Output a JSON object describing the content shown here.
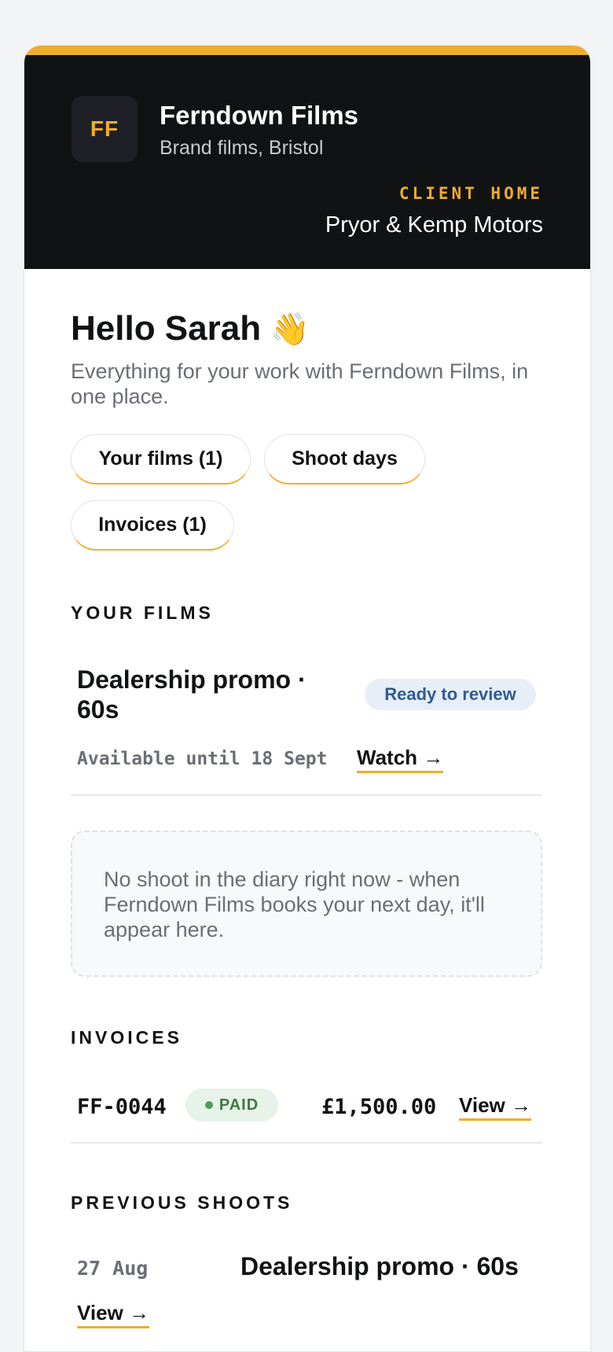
{
  "colors": {
    "accent": "#f0ad2b",
    "header_bg": "#111214",
    "review_badge": "#2d5c95",
    "paid_badge": "#3d7a47"
  },
  "header": {
    "logo_initials": "FF",
    "brand_name": "Ferndown Films",
    "brand_tagline": "Brand films, Bristol",
    "client_label": "CLIENT HOME",
    "client_name": "Pryor & Kemp Motors"
  },
  "greeting": {
    "title": "Hello Sarah",
    "wave": "👋",
    "intro": "Everything for your work with Ferndown Films, in one place."
  },
  "quick_links": [
    "Your films (1)",
    "Shoot days",
    "Invoices (1)"
  ],
  "films": {
    "heading": "YOUR FILMS",
    "items": [
      {
        "title": "Dealership promo · 60s",
        "status": "Ready to review",
        "availability": "Available until 18 Sept",
        "action": "Watch →"
      }
    ]
  },
  "shoots_empty": "No shoot in the diary right now - when Ferndown Films books your next day, it'll appear here.",
  "invoices": {
    "heading": "INVOICES",
    "items": [
      {
        "id": "FF-0044",
        "status": "PAID",
        "amount": "£1,500.00",
        "action": "View →"
      }
    ]
  },
  "previous_shoots": {
    "heading": "PREVIOUS SHOOTS",
    "items": [
      {
        "date": "27 Aug",
        "title": "Dealership promo · 60s",
        "action": "View →"
      }
    ]
  }
}
